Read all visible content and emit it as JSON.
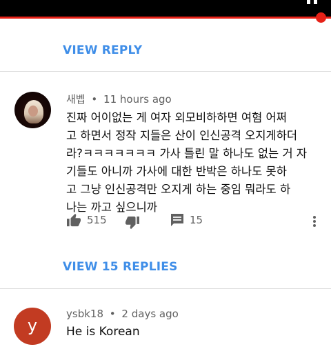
{
  "reply_link_top": "VIEW REPLY",
  "comment1": {
    "author": "새벱",
    "separator": "•",
    "time": "11 hours ago",
    "lines": [
      "진짜 어이없는 게 여자 외모비하하면 여혐 어쩌",
      "고 하면서 정작 지들은 산이 인신공격 오지게하더",
      "라?ㅋㅋㅋㅋㅋㅋㅋ 가사 틀린 말 하나도 없는 거 자",
      "기들도 아니까 가사에 대한  반박은 하나도 못하",
      "고 그냥 인신공격만 오지게 하는 중임 뭐라도 하",
      "나는 까고 싶으니까"
    ],
    "likes": "515",
    "replies_count": "15"
  },
  "reply_link_bottom": "VIEW 15 REPLIES",
  "comment2": {
    "author": "ysbk18",
    "separator": "•",
    "time": "2 days ago",
    "avatar_letter": "y",
    "text": "He is Korean"
  },
  "colors": {
    "link": "#3f8ee8",
    "progress": "#e62117",
    "avatar_y": "#c23b22"
  },
  "icons": [
    "pause-icon",
    "thumbs-up-icon",
    "thumbs-down-icon",
    "comment-icon",
    "more-vert-icon"
  ]
}
